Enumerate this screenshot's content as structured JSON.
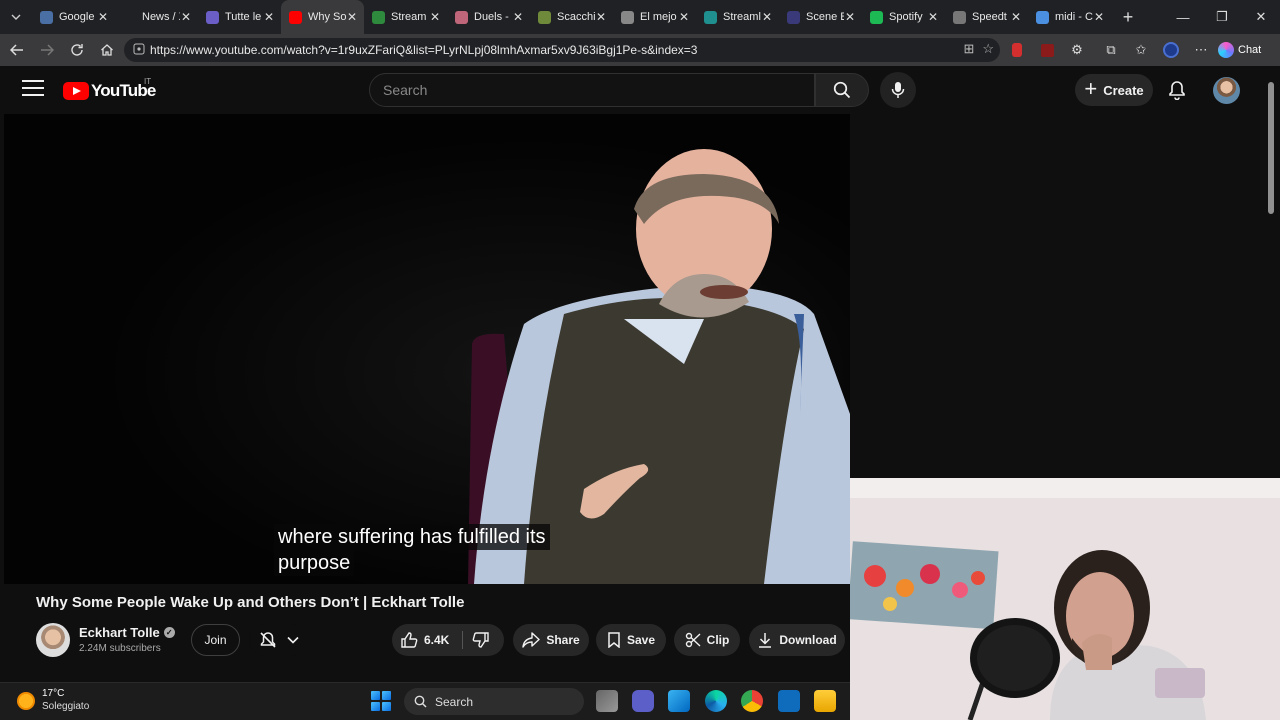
{
  "browser": {
    "tabs": [
      {
        "label": "Google",
        "favicon_color": "#4a6fa5",
        "active": false
      },
      {
        "label": "News / X",
        "favicon_color": "#202124",
        "active": false
      },
      {
        "label": "Tutte le",
        "favicon_color": "#6b5fc7",
        "active": false
      },
      {
        "label": "Why So",
        "favicon_color": "#ff0000",
        "active": true
      },
      {
        "label": "Stream",
        "favicon_color": "#2e8b3e",
        "active": false
      },
      {
        "label": "Duels -",
        "favicon_color": "#c0667a",
        "active": false
      },
      {
        "label": "Scacchi",
        "favicon_color": "#6e8a3a",
        "active": false
      },
      {
        "label": "El mejo",
        "favicon_color": "#888888",
        "active": false
      },
      {
        "label": "Streaml",
        "favicon_color": "#1f8f8f",
        "active": false
      },
      {
        "label": "Scene E",
        "favicon_color": "#3a3a7a",
        "active": false
      },
      {
        "label": "Spotify",
        "favicon_color": "#1db954",
        "active": false
      },
      {
        "label": "Speedt",
        "favicon_color": "#777777",
        "active": false
      },
      {
        "label": "midi - C",
        "favicon_color": "#4a8fe0",
        "active": false
      }
    ],
    "url": "https://www.youtube.com/watch?v=1r9uxZFariQ&list=PLyrNLpj08lmhAxmar5xv9J63iBgj1Pe-s&index=3",
    "chat_label": "Chat"
  },
  "youtube": {
    "logo_text": "YouTube",
    "country_code": "IT",
    "search_placeholder": "Search",
    "create_label": "Create"
  },
  "video": {
    "caption_line1": "where suffering has fulfilled its",
    "caption_line2": "purpose",
    "title": "Why Some People Wake Up and Others Don’t | Eckhart Tolle",
    "channel_name": "Eckhart Tolle",
    "subscribers": "2.24M subscribers",
    "join_label": "Join",
    "like_count": "6.4K",
    "share_label": "Share",
    "save_label": "Save",
    "clip_label": "Clip",
    "download_label": "Download"
  },
  "taskbar": {
    "temperature": "17°C",
    "weather": "Soleggiato",
    "search_label": "Search"
  },
  "colors": {
    "yt_red": "#ff0000",
    "bg_dark": "#0f0f0f",
    "pill_bg": "#272727"
  }
}
